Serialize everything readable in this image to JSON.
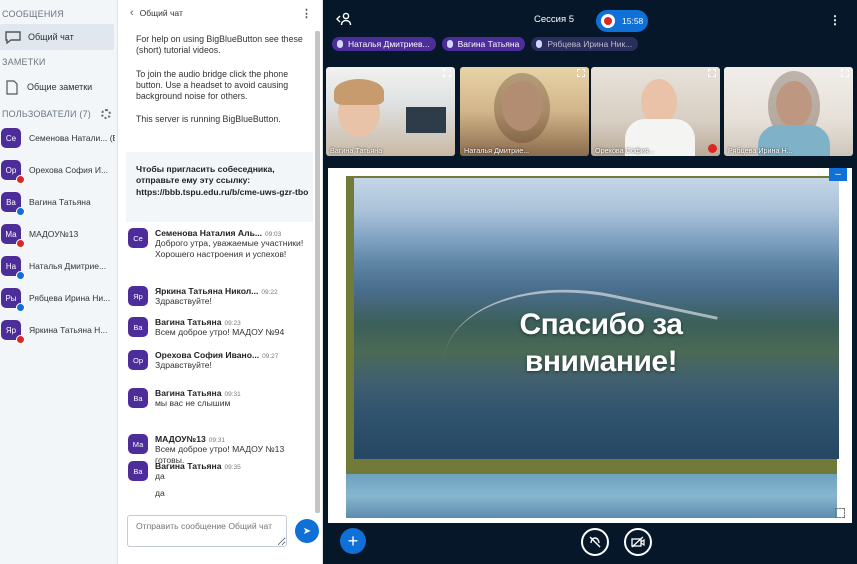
{
  "userlist": {
    "messages_title": "СООБЩЕНИЯ",
    "public_chat_label": "Общий чат",
    "notes_title": "ЗАМЕТКИ",
    "shared_notes_label": "Общие заметки",
    "users_title": "ПОЛЬЗОВАТЕЛИ (7)",
    "users": [
      {
        "initials": "Се",
        "name": "Семенова Натали... (Вы)",
        "badge": "none"
      },
      {
        "initials": "Ор",
        "name": "Орехова София И...",
        "badge": "mute"
      },
      {
        "initials": "Ва",
        "name": "Вагина Татьяна",
        "badge": "listen"
      },
      {
        "initials": "Ма",
        "name": "МАДОУ№13",
        "badge": "mute"
      },
      {
        "initials": "На",
        "name": "Наталья Дмитрие...",
        "badge": "listen"
      },
      {
        "initials": "Ры",
        "name": "Рябцева Ирина Ни...",
        "badge": "listen"
      },
      {
        "initials": "Яр",
        "name": "Яркина Татьяна Н...",
        "badge": "mute"
      }
    ]
  },
  "chat": {
    "title": "Общий чат",
    "welcome_1": "For help on using BigBlueButton see these (short) tutorial videos.",
    "welcome_2": "To join the audio bridge click the phone button. Use a headset to avoid causing background noise for others.",
    "welcome_3": "This server is running BigBlueButton.",
    "invite": "Чтобы пригласить собеседника, отправьте ему эту ссылку: https://bbb.tspu.edu.ru/b/cme-uws-gzr-tbo",
    "messages": [
      {
        "initials": "Се",
        "name": "Семенова Наталия Аль...",
        "time": "09:03",
        "text": "Доброго утра, уважаемые участники! Хорошего настроения и успехов!"
      },
      {
        "initials": "Яр",
        "name": "Яркина Татьяна Никол...",
        "time": "09:22",
        "text": "Здравствуйте!"
      },
      {
        "initials": "Ва",
        "name": "Вагина Татьяна",
        "time": "09:23",
        "text": "Всем доброе утро! МАДОУ №94"
      },
      {
        "initials": "Ор",
        "name": "Орехова София Ивано...",
        "time": "09:27",
        "text": "Здравствуйте!"
      },
      {
        "initials": "Ва",
        "name": "Вагина Татьяна",
        "time": "09:31",
        "text": "мы вас не слышим"
      },
      {
        "initials": "Ма",
        "name": "МАДОУ№13",
        "time": "09:31",
        "text": "Всем доброе утро! МАДОУ №13 готовы."
      },
      {
        "initials": "Ва",
        "name": "Вагина Татьяна",
        "time": "09:35",
        "text": "да"
      },
      {
        "initials": "",
        "name": "",
        "time": "",
        "text": "да"
      }
    ],
    "input_placeholder": "Отправить сообщение Общий чат"
  },
  "main": {
    "session_title": "Сессия 5",
    "recording_time": "15:58",
    "talkers": [
      {
        "name": "Наталья Дмитриев...",
        "muted": false
      },
      {
        "name": "Вагина Татьяна",
        "muted": false
      },
      {
        "name": "Рябцева Ирина Ник...",
        "muted": true
      }
    ],
    "videos": [
      {
        "name": "Вагина Татьяна"
      },
      {
        "name": "Наталья Дмитрие..."
      },
      {
        "name": "Орехова София..."
      },
      {
        "name": "Рябцева Ирина Н..."
      }
    ],
    "slide_text": "Спасибо за внимание!"
  },
  "colors": {
    "brand_blue": "#0f70d7",
    "avatar_purple": "#4d2d99",
    "mute_red": "#df2721",
    "main_bg": "#06172a"
  }
}
